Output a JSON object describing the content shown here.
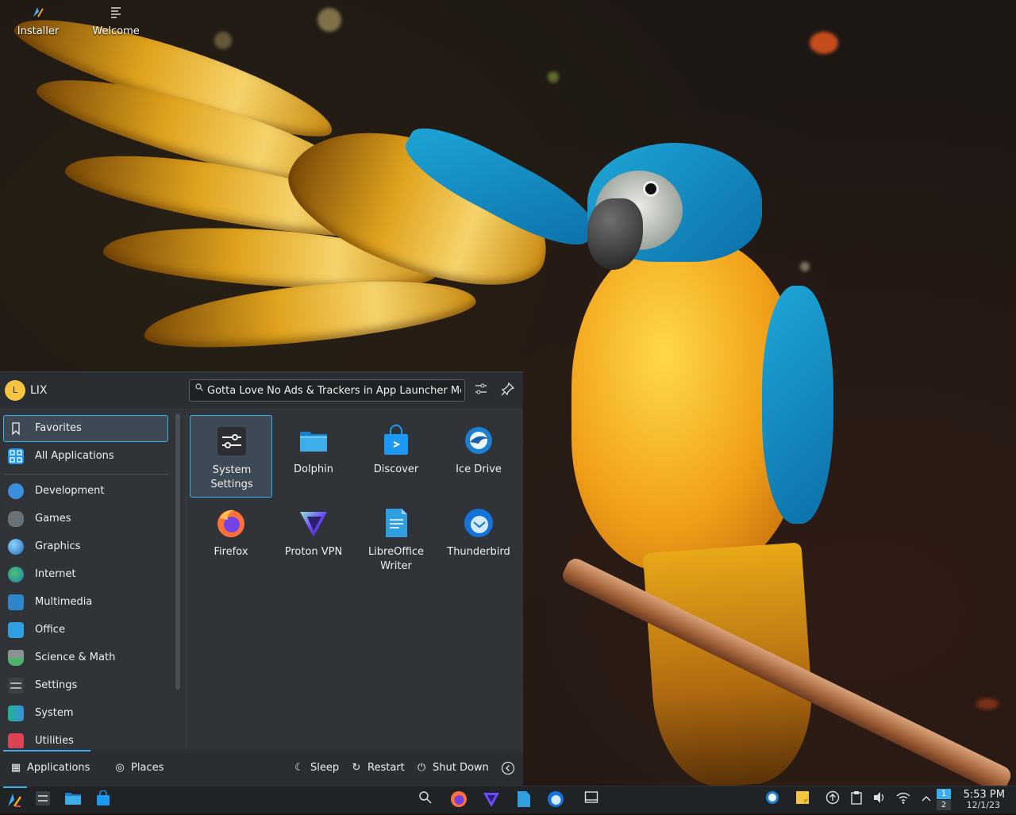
{
  "desktop": {
    "icons": [
      {
        "label": "Installer",
        "icon": "installer-icon"
      },
      {
        "label": "Welcome",
        "icon": "welcome-icon"
      }
    ]
  },
  "launcher": {
    "user": {
      "initial": "L",
      "name": "LIX"
    },
    "search": {
      "value": "Gotta Love No Ads & Trackers in App Launcher Menu"
    },
    "header_buttons": [
      {
        "name": "configure",
        "icon": "sliders-icon"
      },
      {
        "name": "pin",
        "icon": "pin-icon"
      }
    ],
    "categories": [
      {
        "label": "Favorites",
        "icon": "bookmark-icon",
        "selected": true
      },
      {
        "label": "All Applications",
        "icon": "grid-icon"
      },
      {
        "label": "Development",
        "icon": "development-icon"
      },
      {
        "label": "Games",
        "icon": "gamepad-icon"
      },
      {
        "label": "Graphics",
        "icon": "graphics-icon"
      },
      {
        "label": "Internet",
        "icon": "globe-icon"
      },
      {
        "label": "Multimedia",
        "icon": "multimedia-icon"
      },
      {
        "label": "Office",
        "icon": "office-icon"
      },
      {
        "label": "Science & Math",
        "icon": "flask-icon"
      },
      {
        "label": "Settings",
        "icon": "settings-icon"
      },
      {
        "label": "System",
        "icon": "system-icon"
      },
      {
        "label": "Utilities",
        "icon": "utilities-icon"
      }
    ],
    "apps": [
      {
        "label": "System Settings",
        "icon": "system-settings-icon",
        "selected": true
      },
      {
        "label": "Dolphin",
        "icon": "folder-icon"
      },
      {
        "label": "Discover",
        "icon": "store-bag-icon"
      },
      {
        "label": "Ice Drive",
        "icon": "ice-drive-icon"
      },
      {
        "label": "Firefox",
        "icon": "firefox-icon"
      },
      {
        "label": "Proton VPN",
        "icon": "proton-vpn-icon"
      },
      {
        "label": "LibreOffice Writer",
        "icon": "writer-document-icon"
      },
      {
        "label": "Thunderbird",
        "icon": "thunderbird-icon"
      }
    ],
    "footer": {
      "applications": "Applications",
      "places": "Places",
      "sleep": "Sleep",
      "restart": "Restart",
      "shutdown": "Shut Down"
    }
  },
  "taskbar": {
    "pager": [
      "1",
      "2"
    ],
    "clock": {
      "time": "5:53 PM",
      "date": "12/1/23"
    }
  },
  "colors": {
    "accent": "#3daee9",
    "panel": "#31363b",
    "taskbar": "#202326"
  }
}
